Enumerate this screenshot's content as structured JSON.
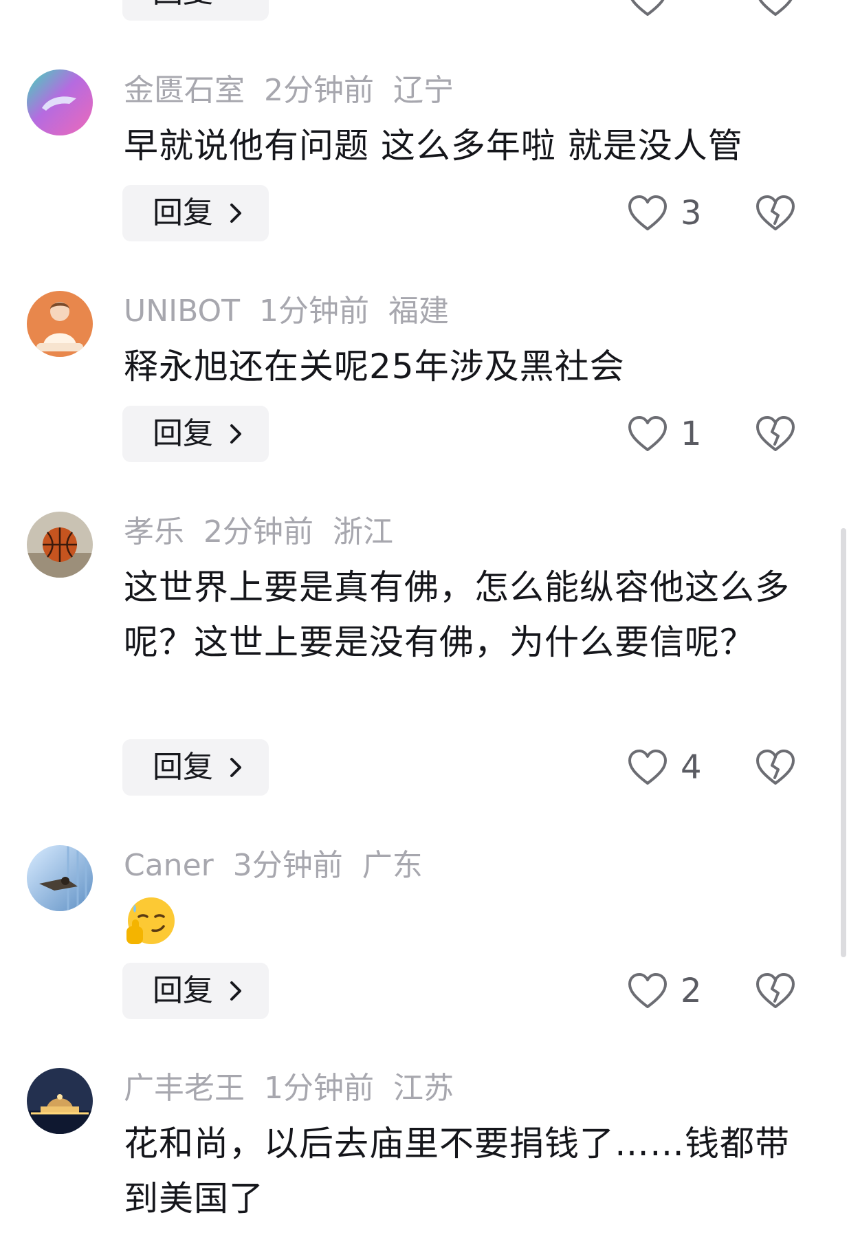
{
  "reply_label": "回复",
  "comments": [
    {
      "username": "金匮石室",
      "time": "2分钟前",
      "location": "辽宁",
      "text": "早就说他有问题 这么多年啦 就是没人管",
      "likes": "3"
    },
    {
      "username": "UNIBOT",
      "time": "1分钟前",
      "location": "福建",
      "text": "释永旭还在关呢25年涉及黑社会",
      "likes": "1"
    },
    {
      "username": "孝乐",
      "time": "2分钟前",
      "location": "浙江",
      "text": "这世界上要是真有佛，怎么能纵容他这么多呢？这世上要是没有佛，为什么要信呢？",
      "likes": "4"
    },
    {
      "username": "Caner",
      "time": "3分钟前",
      "location": "广东",
      "emoji": "smirk-thumbs-up-emoji",
      "likes": "2"
    },
    {
      "username": "广丰老王",
      "time": "1分钟前",
      "location": "江苏",
      "text": "花和尚，以后去庙里不要捐钱了……钱都带到美国了"
    }
  ]
}
